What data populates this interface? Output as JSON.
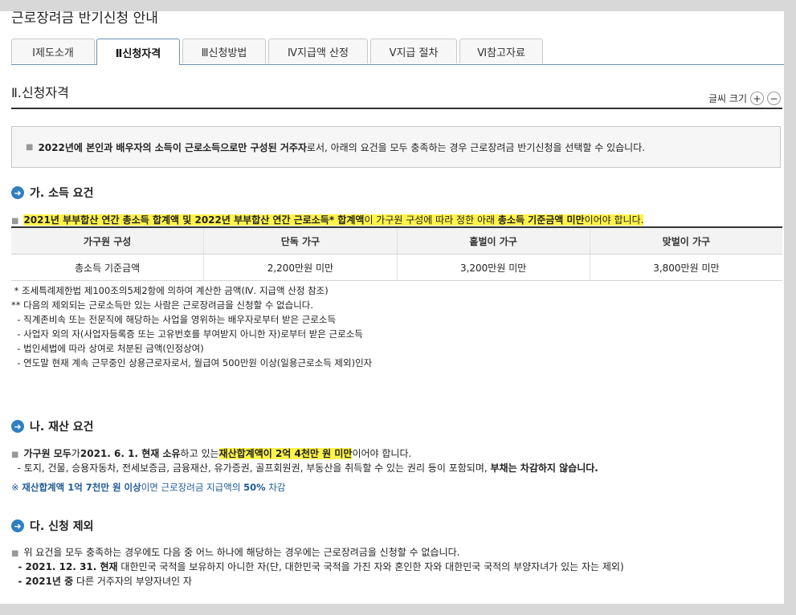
{
  "page_title": "근로장려금 반기신청 안내",
  "tabs": [
    {
      "label": "Ⅰ제도소개"
    },
    {
      "label": "Ⅱ신청자격"
    },
    {
      "label": "Ⅲ신청방법"
    },
    {
      "label": "Ⅳ지급액 산정"
    },
    {
      "label": "Ⅴ지급 절차"
    },
    {
      "label": "Ⅵ참고자료"
    }
  ],
  "section_title": "Ⅱ.신청자격",
  "font_size": {
    "label": "글씨 크기",
    "plus": "+",
    "minus": "−"
  },
  "intro": {
    "bold": "2022년에 본인과 배우자의 소득이 근로소득으로만 구성된 거주자",
    "rest": "로서, 아래의 요건을 모두 충족하는 경우 근로장려금 반기신청을 선택할 수 있습니다."
  },
  "income": {
    "heading": "가. 소득 요건",
    "req_bold": "2021년 부부합산 연간 총소득 합계액 및 2022년 부부합산 연간 근로소득* 합계액",
    "req_mid": "이 가구원 구성에 따라 정한 아래 ",
    "req_bold2": "총소득 기준금액 미만",
    "req_end": "이어야 합니다.",
    "table": {
      "headers": [
        "가구원 구성",
        "단독 가구",
        "홑벌이 가구",
        "맞벌이 가구"
      ],
      "row": [
        "총소득 기준금액",
        "2,200만원 미만",
        "3,200만원 미만",
        "3,800만원 미만"
      ]
    },
    "notes": [
      " * 조세특례제한법 제100조의5제2항에 의하여 계산한 금액(Ⅳ. 지급액 산정 참조)",
      "** 다음의 제외되는 근로소득만 있는 사람은 근로장려금을 신청할 수 없습니다.",
      "  - 직계존비속 또는 전문직에 해당하는 사업을 영위하는 배우자로부터 받은 근로소득",
      "  - 사업자 외의 자(사업자등록증 또는 고유번호를 부여받지 아니한 자)로부터 받은 근로소득",
      "  - 법인세법에 따라 상여로 처분된 금액(인정상여)",
      "  - 연도말 현재 계속 근무중인 상용근로자로서, 월급여 500만원 이상(일용근로소득 제외)인자"
    ]
  },
  "property": {
    "heading": "나. 재산 요건",
    "l1_bold1": "가구원 모두",
    "l1_t1": "가",
    "l1_bold2": "2021. 6. 1. 현재 소유",
    "l1_t2": "하고 있는",
    "l1_hl": "재산합계액이 2억 4천만 원 미만",
    "l1_t3": "이어야 합니다.",
    "l2_t": "  - 토지, 건물, 승용자동차, 전세보증금, 금융재산, 유가증권, 골프회원권, 부동산을 취득할 수 있는 권리 등이 포함되며, ",
    "l2_bold": "부채는 차감하지 않습니다.",
    "note_mark": "※ ",
    "note_bold1": "재산합계액 1억 7천만 원 이상",
    "note_t1": "이면 근로장려금 지급액의 ",
    "note_bold2": "50%",
    "note_t2": " 차감"
  },
  "exclusion": {
    "heading": "다. 신청 제외",
    "l1": "위 요건을 모두 충족하는 경우에도 다음 중 어느 하나에 해당하는 경우에는 근로장려금을 신청할 수 없습니다.",
    "l2_bold": "  - 2021. 12. 31. 현재",
    "l2_t": " 대한민국 국적을 보유하지 아니한 자(단, 대한민국 국적을 가진 자와 혼인한 자와 대한민국 국적의 부양자녀가 있는 자는 제외)",
    "l3_bold": "  - 2021년 중",
    "l3_t": " 다른 거주자의 부양자녀인 자"
  },
  "colors": {
    "highlight": "#fff34a",
    "heading_icon": "#2f7fc1",
    "note_blue": "#1f5a96"
  }
}
